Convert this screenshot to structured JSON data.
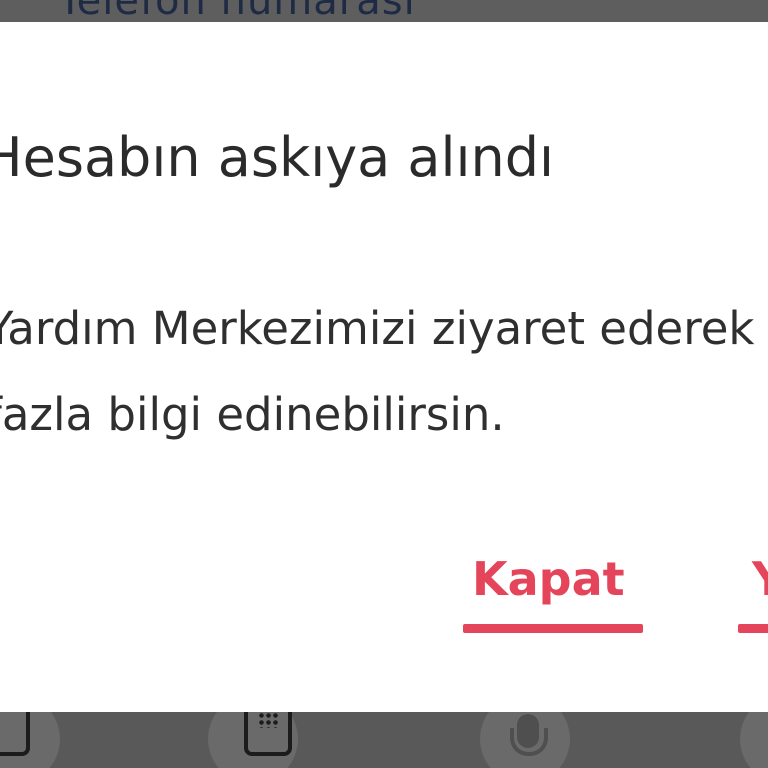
{
  "background": {
    "top_field_text": "Telefon numarası"
  },
  "dialog": {
    "title": "Hesabın askıya alındı",
    "body_line1": "Yardım Merkezimizi ziyaret ederek daha",
    "body_line2": "fazla bilgi edinebilirsin.",
    "buttons": {
      "close_label": "Kapat",
      "secondary_label": "Yardım"
    }
  },
  "keyboard": {
    "icons": [
      "frame-icon",
      "keypad-icon",
      "microphone-icon"
    ]
  },
  "colors": {
    "accent": "#e4455a",
    "dialog_bg": "#ffffff",
    "overlay": "#5c5c5c",
    "title_text": "#2b2b2b"
  }
}
